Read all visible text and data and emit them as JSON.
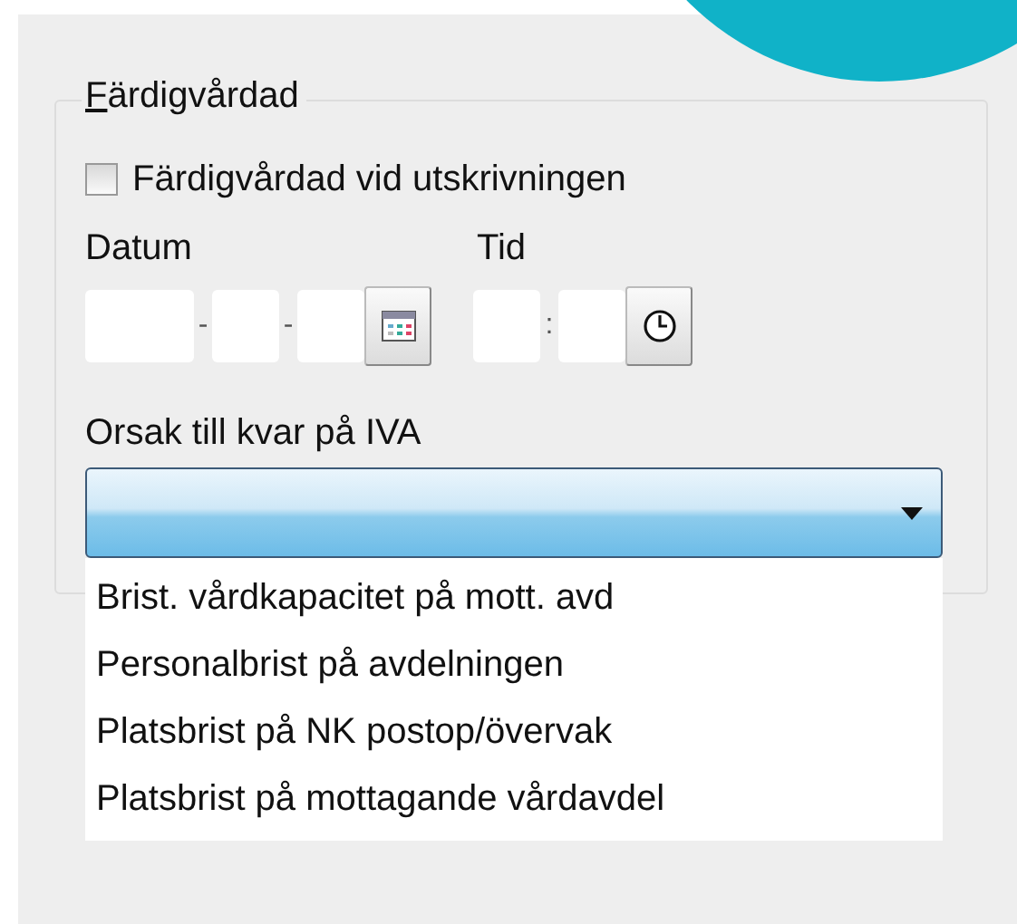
{
  "group": {
    "legend": "Färdigvårdad",
    "legend_first_letter_underlined": true
  },
  "checkbox": {
    "label": "Färdigvårdad vid utskrivningen",
    "checked": false
  },
  "date": {
    "label": "Datum",
    "separators": [
      "-",
      "-"
    ]
  },
  "time": {
    "label": "Tid",
    "separator": ":"
  },
  "reason": {
    "label": "Orsak till kvar på IVA",
    "expanded": true,
    "options": [
      {
        "label": "Brist. vårdkapacitet på mott. avd",
        "selected": false
      },
      {
        "label": "Personalbrist på avdelningen",
        "selected": false
      },
      {
        "label": "Platsbrist på NK postop/övervak",
        "selected": false
      },
      {
        "label": "Platsbrist på mottagande vårdavdel",
        "selected": false
      }
    ]
  }
}
